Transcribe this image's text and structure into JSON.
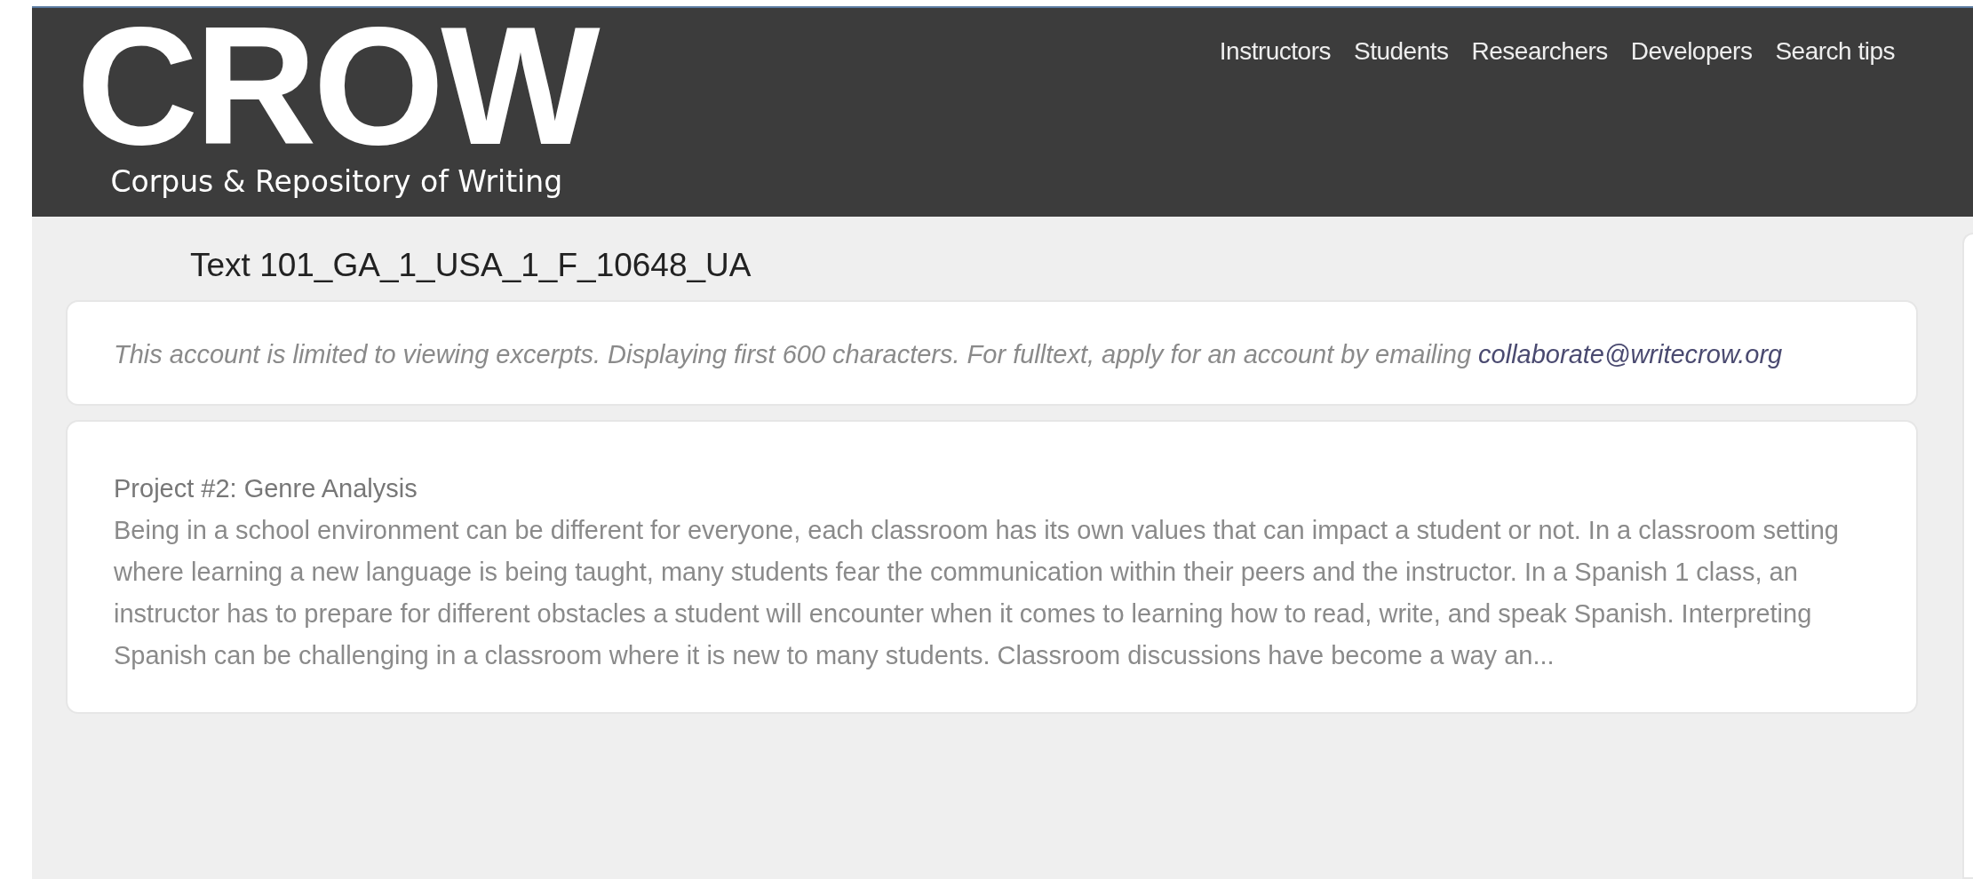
{
  "header": {
    "logo": {
      "wordmark": "CROW",
      "tagline": "Corpus & Repository of Writing"
    },
    "nav": [
      "Instructors",
      "Students",
      "Researchers",
      "Developers",
      "Search tips"
    ]
  },
  "title": "Text 101_GA_1_USA_1_F_10648_UA",
  "notice": {
    "text": "This account is limited to viewing excerpts. Displaying first 600 characters. For fulltext, apply for an account by emailing",
    "email": "collaborate@writecrow.org"
  },
  "excerpt": {
    "heading": "Project #2: Genre Analysis",
    "body": "Being in a school environment can be different for everyone, each classroom has its own values that can impact a student or not. In a classroom setting where learning a new language is being taught, many students fear the communication within their peers and the instructor. In a Spanish 1 class, an instructor has to prepare for different obstacles a student will encounter when it comes to learning how to read, write, and speak Spanish. Interpreting Spanish can be challenging in a classroom where it is new to many students. Classroom discussions have become a way an..."
  }
}
